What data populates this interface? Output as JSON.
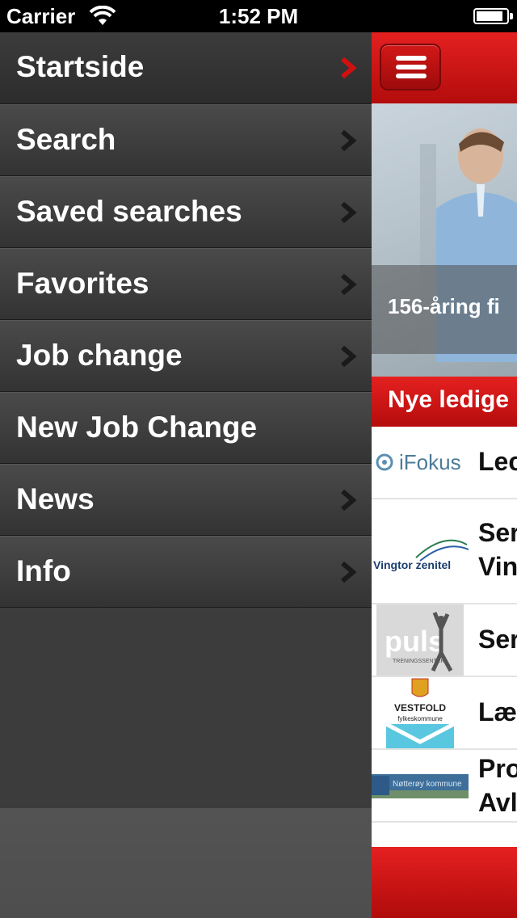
{
  "status_bar": {
    "carrier": "Carrier",
    "time": "1:52 PM",
    "battery_level": 0.9
  },
  "menu": {
    "items": [
      {
        "label": "Startside",
        "chevron": true,
        "active": true
      },
      {
        "label": "Search",
        "chevron": true,
        "active": false
      },
      {
        "label": "Saved searches",
        "chevron": true,
        "active": false
      },
      {
        "label": "Favorites",
        "chevron": true,
        "active": false
      },
      {
        "label": "Job change",
        "chevron": true,
        "active": false
      },
      {
        "label": "New Job Change",
        "chevron": false,
        "active": false
      },
      {
        "label": "News",
        "chevron": true,
        "active": false
      },
      {
        "label": "Info",
        "chevron": true,
        "active": false
      }
    ]
  },
  "main": {
    "menu_button_icon": "hamburger-icon",
    "hero_caption": "156-åring fi",
    "section_header": "Nye ledige",
    "jobs": [
      {
        "logo": "iFokus",
        "title": "Lec"
      },
      {
        "logo": "Vingtor zenitel",
        "title": "Ser",
        "title2": "Vin"
      },
      {
        "logo": "puls",
        "logo_sub": "TRENINGSSENTER",
        "title": "Ser"
      },
      {
        "logo": "VESTFOLD",
        "logo_sub": "fylkeskommune",
        "title": "Læ"
      },
      {
        "logo": "Nøtterøy kommune",
        "title": "Pro",
        "title2": "Avl"
      }
    ]
  },
  "colors": {
    "accent_red": "#d01515",
    "chevron_active": "#d01010",
    "chevron": "#1a1a1a"
  }
}
